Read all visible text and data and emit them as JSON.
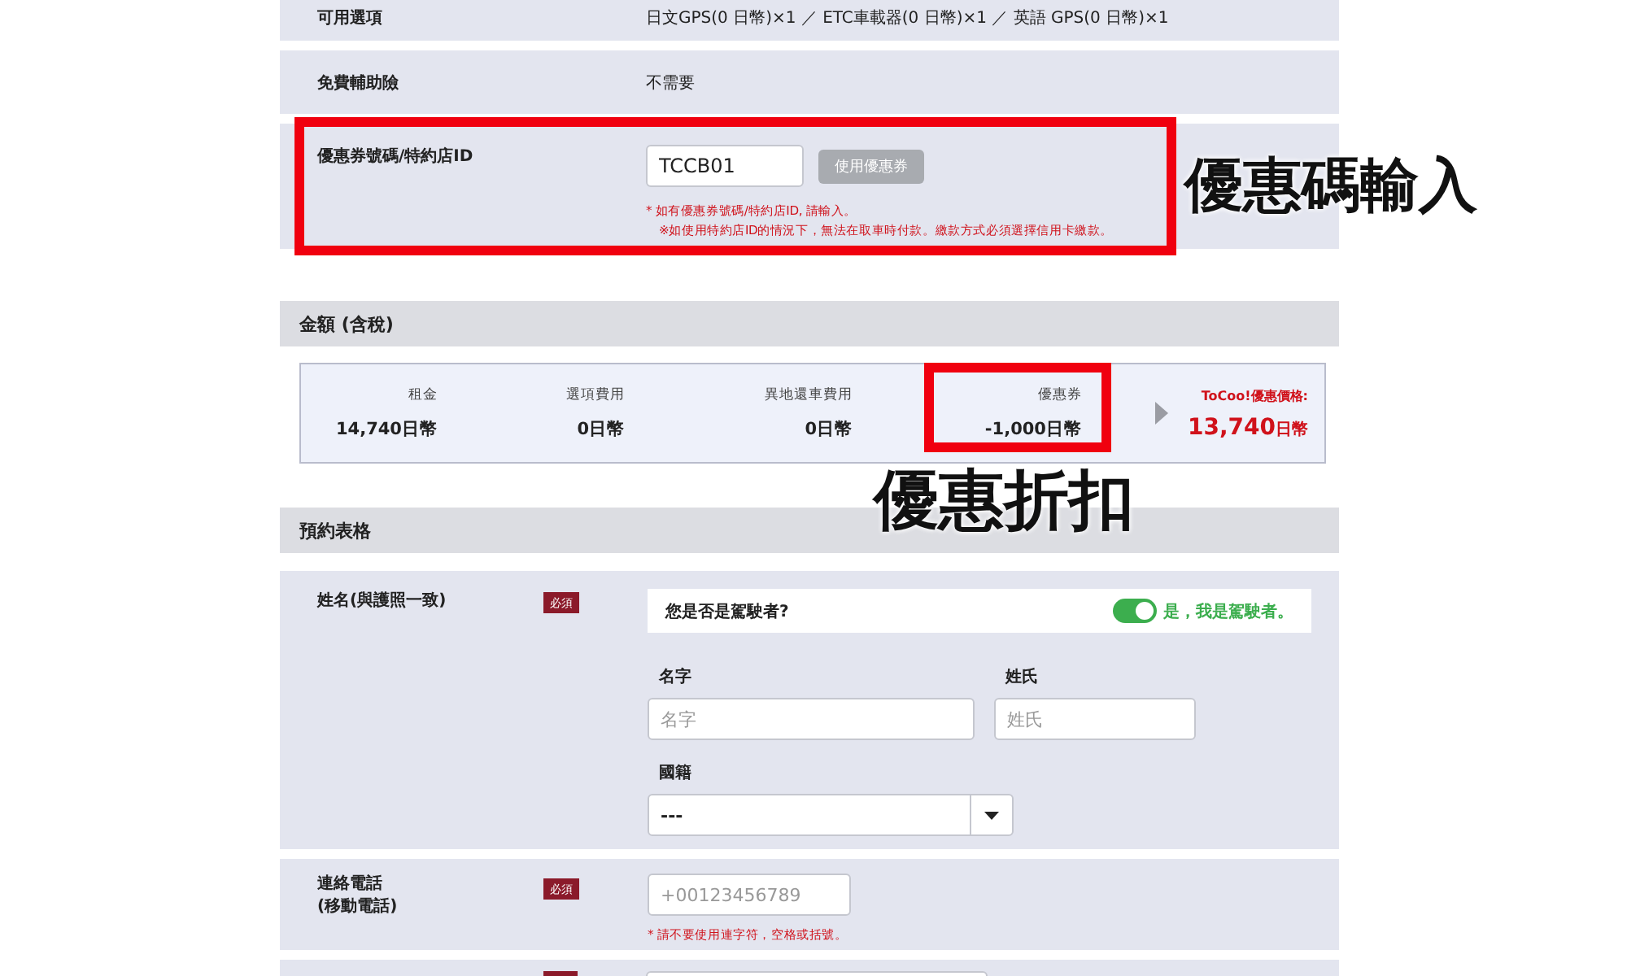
{
  "details": [
    {
      "label": "可用選項",
      "value": "日文GPS(0 日幣)×1 ／ ETC車載器(0 日幣)×1 ／ 英語 GPS(0 日幣)×1"
    },
    {
      "label": "免費輔助險",
      "value": "不需要"
    }
  ],
  "coupon": {
    "label": "優惠券號碼/特約店ID",
    "value": "TCCB01",
    "button": "使用優惠券",
    "notes": [
      "* 如有優惠券號碼/特約店ID, 請輸入。",
      "※如使用特約店ID的情況下，無法在取車時付款。繳款方式必須選擇信用卡繳款。"
    ]
  },
  "amount_section": {
    "title": "金額 (含稅)",
    "items": [
      {
        "label": "租金",
        "value": "14,740日幣"
      },
      {
        "label": "選項費用",
        "value": "0日幣"
      },
      {
        "label": "異地還車費用",
        "value": "0日幣"
      },
      {
        "label": "優惠券",
        "value": "-1,000日幣"
      }
    ],
    "total": {
      "label": "ToCoo!優惠價格:",
      "amount": "13,740",
      "unit": "日幣"
    }
  },
  "form_section": {
    "title": "預約表格",
    "name_row": {
      "label": "姓名(與護照一致)",
      "badge": "必須",
      "driver_question": "您是否是駕駛者?",
      "driver_toggle": {
        "on": true,
        "label": "是，我是駕駛者。"
      },
      "first_name": {
        "label": "名字",
        "placeholder": "名字"
      },
      "last_name": {
        "label": "姓氏",
        "placeholder": "姓氏"
      },
      "nationality": {
        "label": "國籍",
        "value": "---"
      }
    },
    "phone_row": {
      "label": "連絡電話",
      "sublabel": "(移動電話)",
      "badge": "必須",
      "placeholder": "+00123456789",
      "note": "* 請不要使用連字符，空格或括號。"
    }
  },
  "annotations": [
    {
      "text": "優惠碼輸入"
    },
    {
      "text": "優惠折扣"
    }
  ]
}
